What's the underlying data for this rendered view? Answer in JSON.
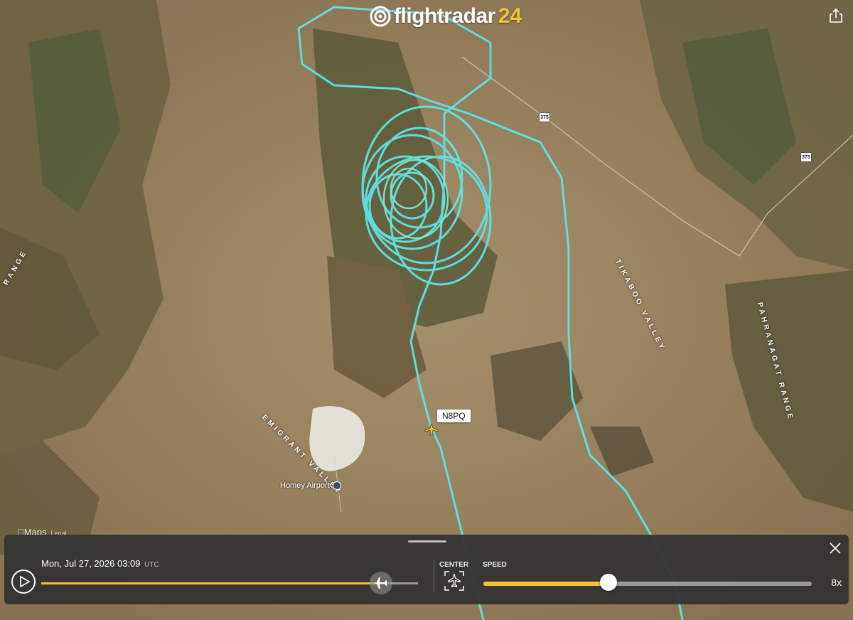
{
  "brand": {
    "name": "flightradar",
    "suffix": "24",
    "accent": "#f2c230"
  },
  "map": {
    "attribution": "Maps",
    "legal": "Legal",
    "track_color": "#5fe3e6",
    "aircraft": {
      "callsign": "N8PQ"
    },
    "airport": "Homey Airport",
    "places": [
      "EMIGRANT VALLEY",
      "TIKABOO VALLEY",
      "PAHRANAGAT RANGE",
      "RANGE"
    ],
    "road_shield": "375"
  },
  "playback": {
    "date": "Mon, Jul 27, 2026",
    "time": "03:09",
    "timezone": "UTC",
    "timeline_progress": 0.9,
    "center_label": "CENTER",
    "speed_label": "SPEED",
    "speed_value": "8x",
    "speed_fraction": 0.38
  },
  "icons": [
    "share-icon",
    "close-icon",
    "play-icon",
    "plane-icon",
    "center-icon"
  ]
}
